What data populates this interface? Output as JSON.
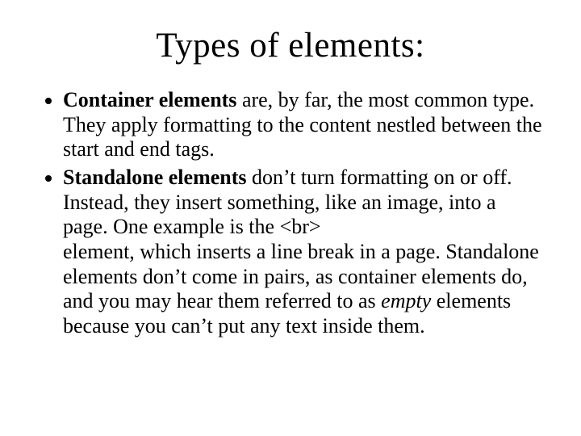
{
  "title": "Types of elements:",
  "bullets": [
    {
      "lead": "Container elements",
      "rest": " are, by far, the most common type. They apply formatting to the content nestled between the start and end tags."
    },
    {
      "lead": "Standalone elements",
      "rest_before_br": " don’t turn formatting on or off. Instead, they insert something, like an image, into a page. One example is the ",
      "br_tag": "<br>",
      "rest_after_br": "element, which inserts a line break in a page. Standalone elements don’t come in pairs, as container elements do, and you may hear them referred to as ",
      "empty_word": "empty",
      "rest_tail": " elements because you can’t put any text inside them."
    }
  ]
}
